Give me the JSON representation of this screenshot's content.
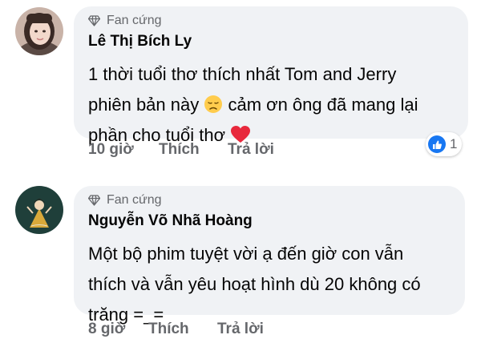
{
  "comments": [
    {
      "avatar_icon": "female-user-photo",
      "badge": "Fan cứng",
      "name": "Lê Thị Bích Ly",
      "text_line1": "1 thời tuổi thơ thích nhất Tom and Jerry",
      "text_line2_a": "phiên bản này",
      "text_line2_b": "cảm ơn ông đã mang lại",
      "text_line3": "phần cho tuổi thơ",
      "emoji_1": "disappointed-face",
      "emoji_2": "red-heart",
      "time": "10 giờ",
      "like": "Thích",
      "reply": "Trả lời",
      "reaction_icon": "like-icon",
      "reaction_count": "1"
    },
    {
      "avatar_icon": "illustrated-girl-avatar",
      "badge": "Fan cứng",
      "name": "Nguyễn Võ Nhã Hoàng",
      "text_line1": "Một bộ phim tuyệt vời ạ đến giờ con vẫn",
      "text_line2": "thích và vẫn yêu hoạt hình dù 20 không có",
      "text_line3": "trăng =_=",
      "time": "8 giờ",
      "like": "Thích",
      "reply": "Trả lời"
    }
  ],
  "colors": {
    "bubble": "#f0f2f5",
    "secondary_text": "#65676b",
    "like_blue": "#1877f2"
  }
}
